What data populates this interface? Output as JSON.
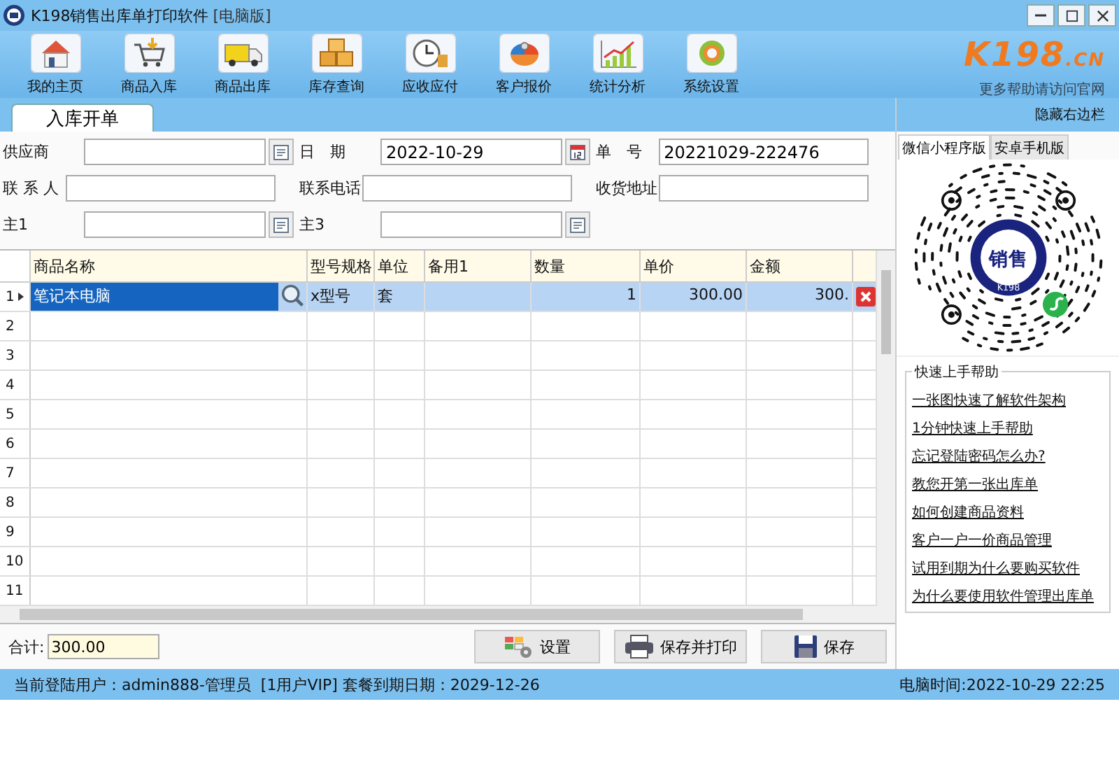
{
  "window": {
    "title": "K198销售出库单打印软件",
    "edition": "[电脑版]"
  },
  "toolbar": [
    {
      "label": "我的主页",
      "kind": "home"
    },
    {
      "label": "商品入库",
      "kind": "cart"
    },
    {
      "label": "商品出库",
      "kind": "truck"
    },
    {
      "label": "库存查询",
      "kind": "boxes"
    },
    {
      "label": "应收应付",
      "kind": "clock"
    },
    {
      "label": "客户报价",
      "kind": "pie"
    },
    {
      "label": "统计分析",
      "kind": "chart"
    },
    {
      "label": "系统设置",
      "kind": "gear"
    }
  ],
  "brand": {
    "logo": "K198",
    "domain": ".CN",
    "tagline": "更多帮助请访问官网"
  },
  "tabs": [
    {
      "label": "入库开单",
      "selected": true
    }
  ],
  "hide_sidebar": "隐藏右边栏",
  "form": [
    [
      {
        "label": "供应商",
        "kind": "picker"
      },
      {
        "label": "日　期",
        "value": "2022-10-29",
        "kind": "calendar"
      },
      {
        "label": "单　号",
        "value": "20221029-222476",
        "kind": "plain"
      }
    ],
    [
      {
        "label": "联 系 人",
        "kind": "plain"
      },
      {
        "label": "联系电话",
        "kind": "plain"
      },
      {
        "label": "收货地址",
        "kind": "plain"
      }
    ],
    [
      {
        "label": "主1",
        "kind": "picker"
      },
      {
        "label": "主3",
        "kind": "picker"
      }
    ]
  ],
  "table": {
    "columns": [
      "商品名称",
      "型号规格",
      "单位",
      "备用1",
      "数量",
      "单价",
      "金额"
    ],
    "rows": [
      {
        "number": "1",
        "selected": true,
        "cells": [
          "笔记本电脑",
          "x型号",
          "套",
          "",
          "1",
          "300.00",
          "300."
        ]
      },
      {
        "number": "2",
        "selected": false,
        "cells": []
      },
      {
        "number": "3",
        "selected": false,
        "cells": []
      },
      {
        "number": "4",
        "selected": false,
        "cells": []
      },
      {
        "number": "5",
        "selected": false,
        "cells": []
      },
      {
        "number": "6",
        "selected": false,
        "cells": []
      },
      {
        "number": "7",
        "selected": false,
        "cells": []
      },
      {
        "number": "8",
        "selected": false,
        "cells": []
      },
      {
        "number": "9",
        "selected": false,
        "cells": []
      },
      {
        "number": "10",
        "selected": false,
        "cells": []
      },
      {
        "number": "11",
        "selected": false,
        "cells": []
      }
    ]
  },
  "footer": {
    "total_label": "合计:",
    "total": "300.00",
    "buttons": [
      {
        "label": "设置",
        "kind": "settings"
      },
      {
        "label": "保存并打印",
        "kind": "print"
      },
      {
        "label": "保存",
        "kind": "save"
      }
    ]
  },
  "sidebar": {
    "tabs": [
      {
        "label": "微信小程序版",
        "selected": true
      },
      {
        "label": "安卓手机版",
        "selected": false
      }
    ],
    "qr": {
      "center": "销售",
      "sub": "K198"
    },
    "help_title": "快速上手帮助",
    "links": [
      "一张图快速了解软件架构",
      "1分钟快速上手帮助",
      "忘记登陆密码怎么办?",
      "教您开第一张出库单",
      "如何创建商品资料",
      "客户一户一价商品管理",
      "试用到期为什么要购买软件",
      "为什么要使用软件管理出库单"
    ]
  },
  "status_bar": {
    "user": "当前登陆用户：admin888-管理员  [1用户VIP] 套餐到期日期：2029-12-26",
    "time": "电脑时间:2022-10-29 22:25"
  }
}
